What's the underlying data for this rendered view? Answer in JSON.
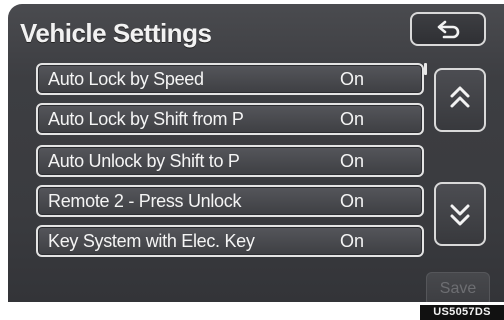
{
  "header": {
    "title": "Vehicle Settings",
    "back_icon": "back-arrow-icon"
  },
  "settings": [
    {
      "label": "Auto Lock by Speed",
      "value": "On"
    },
    {
      "label": "Auto Lock by Shift from P",
      "value": "On"
    },
    {
      "label": "Auto Unlock by Shift to P",
      "value": "On"
    },
    {
      "label": "Remote 2 - Press Unlock",
      "value": "On"
    },
    {
      "label": "Key System with Elec. Key",
      "value": "On"
    }
  ],
  "pager": {
    "up_icon": "double-chevron-up-icon",
    "down_icon": "double-chevron-down-icon",
    "scroll_position": 0
  },
  "footer": {
    "save_label": "Save",
    "save_enabled": false
  },
  "image_code": "US5057DS",
  "colors": {
    "screen_background": "#3d3e42",
    "text": "#f4f4f4",
    "border": "#e4e4e4",
    "disabled_text": "#6d6e72"
  }
}
